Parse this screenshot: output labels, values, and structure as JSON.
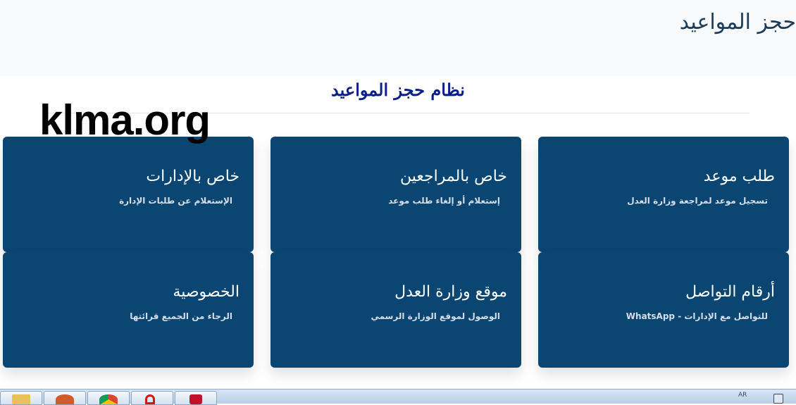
{
  "header": {
    "title": "حجز المواعيد"
  },
  "system": {
    "heading": "نظام حجز المواعيد"
  },
  "watermark": {
    "text": "klma.org"
  },
  "cards": [
    {
      "title": "طلب موعد",
      "subtitle": "تسجيل موعد لمراجعة وزارة العدل"
    },
    {
      "title": "خاص بالمراجعين",
      "subtitle": "إستعلام أو إلغاء طلب موعد"
    },
    {
      "title": "خاص بالإدارات",
      "subtitle": "الإستعلام عن طلبات الإدارة"
    },
    {
      "title": "أرقام التواصل",
      "subtitle": "للتواصل مع الإدارات - WhatsApp"
    },
    {
      "title": "موقع وزارة العدل",
      "subtitle": "الوصول لموقع الوزارة الرسمي"
    },
    {
      "title": "الخصوصية",
      "subtitle": "الرجاء من الجميع قرائتها"
    }
  ],
  "taskbar": {
    "apps": [
      "folder-icon",
      "media-player-icon",
      "chrome-icon",
      "opera-icon",
      "news-app-icon"
    ],
    "language": "AR"
  }
}
